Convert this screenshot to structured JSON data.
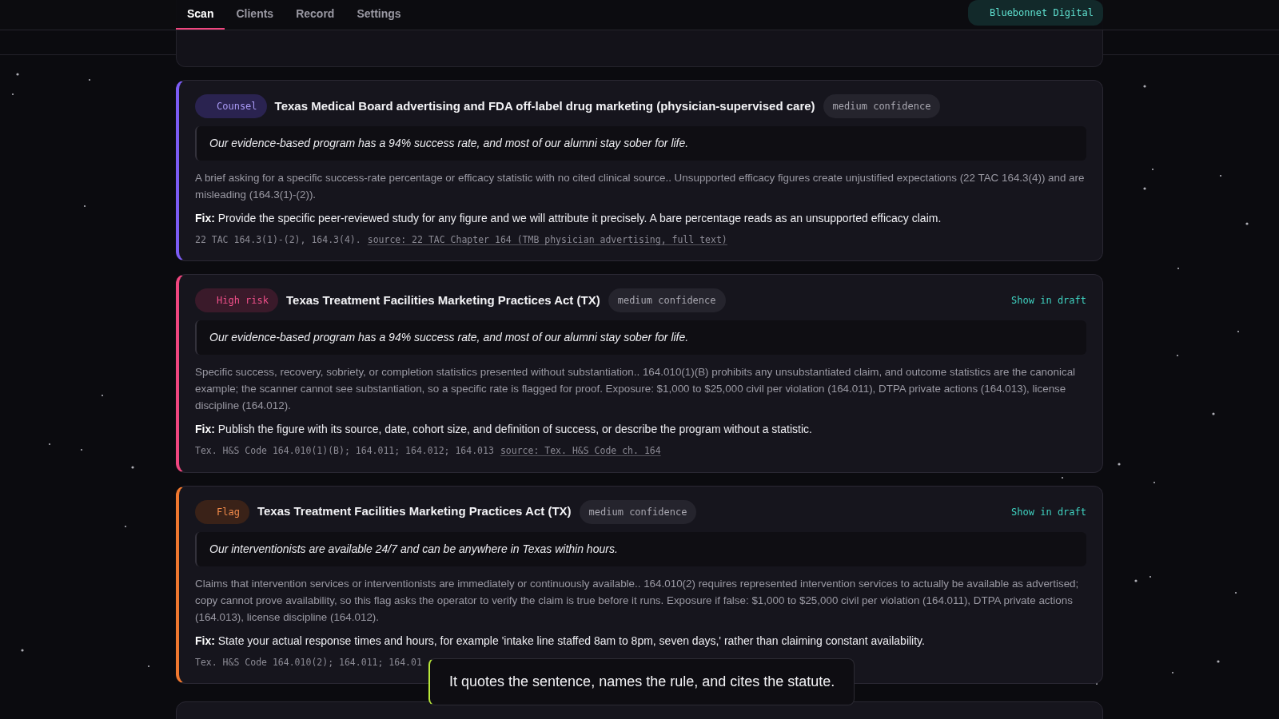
{
  "nav": {
    "tabs": [
      {
        "label": "Scan",
        "selected": true
      },
      {
        "label": "Clients",
        "selected": false
      },
      {
        "label": "Record",
        "selected": false
      },
      {
        "label": "Settings",
        "selected": false
      }
    ],
    "workspace": "Bluebonnet Digital"
  },
  "findings": [
    {
      "kind": "counsel",
      "badge": "Counsel",
      "title": "Texas Medical Board advertising and FDA off-label drug marketing (physician-supervised care)",
      "confidence": "medium confidence",
      "quote": "Our evidence-based program has a 94% success rate, and most of our alumni stay sober for life.",
      "explanation": "A brief asking for a specific success-rate percentage or efficacy statistic with no cited clinical source.. Unsupported efficacy figures create unjustified expectations (22 TAC 164.3(4)) and are misleading (164.3(1)-(2)).",
      "fix": "**Fix:** Provide the specific peer-reviewed study for any figure and we will attribute it precisely. A bare percentage reads as an unsupported efficacy claim.",
      "citation": "22 TAC 164.3(1)-(2), 164.3(4).",
      "source": "source: 22 TAC Chapter 164 (TMB physician advertising, full text)"
    },
    {
      "kind": "high_risk",
      "badge": "High risk",
      "title": "Texas Treatment Facilities Marketing Practices Act (TX)",
      "confidence": "medium confidence",
      "action": "Show in draft",
      "quote": "Our evidence-based program has a 94% success rate, and most of our alumni stay sober for life.",
      "explanation": "Specific success, recovery, sobriety, or completion statistics presented without substantiation.. 164.010(1)(B) prohibits any unsubstantiated claim, and outcome statistics are the canonical example; the scanner cannot see substantiation, so a specific rate is flagged for proof. Exposure: $1,000 to $25,000 civil per violation (164.011), DTPA private actions (164.013), license discipline (164.012).",
      "fix": "**Fix:** Publish the figure with its source, date, cohort size, and definition of success, or describe the program without a statistic.",
      "citation": "Tex. H&S Code 164.010(1)(B); 164.011; 164.012; 164.013",
      "source": "source: Tex. H&S Code ch. 164"
    },
    {
      "kind": "flag",
      "badge": "Flag",
      "title": "Texas Treatment Facilities Marketing Practices Act (TX)",
      "confidence": "medium confidence",
      "action": "Show in draft",
      "quote": "Our interventionists are available 24/7 and can be anywhere in Texas within hours.",
      "explanation": "Claims that intervention services or interventionists are immediately or continuously available.. 164.010(2) requires represented intervention services to actually be available as advertised; copy cannot prove availability, so this flag asks the operator to verify the claim is true before it runs. Exposure if false: $1,000 to $25,000 civil per violation (164.011), DTPA private actions (164.013), license discipline (164.012).",
      "fix": "**Fix:** State your actual response times and hours, for example 'intake line staffed 8am to 8pm, seven days,' rather than claiming constant availability.",
      "citation": "Tex. H&S Code 164.010(2); 164.011; 164.01"
    }
  ],
  "toast": {
    "message": "It quotes the sentence, names the rule, and cites the statute."
  }
}
